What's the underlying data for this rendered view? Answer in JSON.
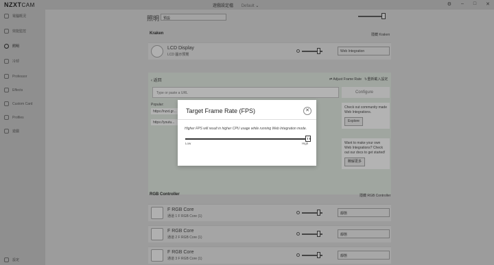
{
  "app": {
    "logo": "NZXT",
    "logo_suffix": "CAM"
  },
  "titlebar": {
    "profile_label": "遊戲設定檔",
    "profile_value": "Default",
    "icons": [
      "gear-icon",
      "minimize-icon",
      "maximize-icon",
      "close-icon"
    ]
  },
  "sidebar": {
    "items": [
      {
        "label": "電腦概況",
        "icon": "monitor-icon"
      },
      {
        "label": "效能監控",
        "icon": "gauge-icon"
      },
      {
        "label": "照明",
        "icon": "bulb-icon"
      },
      {
        "label": "冷却",
        "icon": "fan-icon"
      },
      {
        "label": "Professor",
        "icon": "cpu-icon"
      },
      {
        "label": "Effects",
        "icon": "sparkle-icon"
      },
      {
        "label": "Custom Card",
        "icon": "card-icon"
      },
      {
        "label": "Profiles",
        "icon": "profiles-icon"
      },
      {
        "label": "遊戲",
        "icon": "game-icon"
      }
    ],
    "settings_label": "設定"
  },
  "header": {
    "title": "照明",
    "select_value": "預設"
  },
  "kraken": {
    "title": "Kraken",
    "link": "隱藏 Kraken",
    "device_name": "LCD Display",
    "device_sub": "LCD 圖示預覽",
    "mode": "Web Integration"
  },
  "integration": {
    "back": "返回",
    "adjust": "Adjust Frame Rate",
    "reset": "重新載入設定",
    "url_placeholder": "Type or paste a URL",
    "configure": "Configure",
    "popular_label": "Popular:",
    "popular_urls": [
      "https://nzxt.gr...",
      "https://youtu..."
    ],
    "community_text": "Check out community made Web Integrations.",
    "explore": "Explore",
    "make_text": "Want to make your own Web Integrations? Check out our docs to get started!",
    "learn_more": "瞭解更多"
  },
  "rgb": {
    "title": "RGB Controller",
    "link": "隱藏 RGB Controller",
    "devices": [
      {
        "name": "F RGB Core",
        "sub": "通道 1 F RGB Core (1)",
        "mode": "靜態"
      },
      {
        "name": "F RGB Core",
        "sub": "通道 2 F RGB Core (1)",
        "mode": "靜態"
      },
      {
        "name": "F RGB Core",
        "sub": "通道 3 F RGB Core (1)",
        "mode": "靜態"
      }
    ]
  },
  "modal": {
    "title": "Target Frame Rate (FPS)",
    "description": "Higher FPS will result in higher CPU usage while running Web Integration mode.",
    "low": "Low",
    "high": "High",
    "value_fraction": 1.0
  }
}
